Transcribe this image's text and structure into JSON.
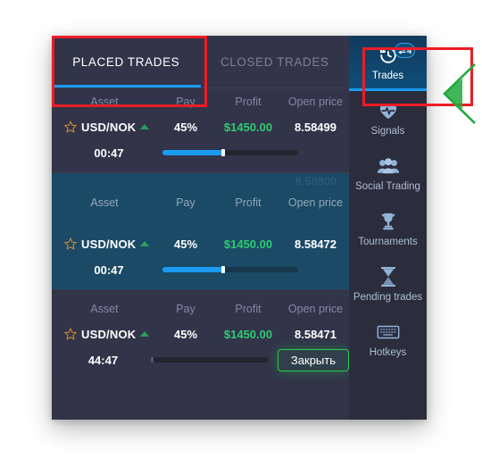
{
  "tabs": [
    {
      "label": "PLACED TRADES",
      "active": true
    },
    {
      "label": "CLOSED TRADES",
      "active": false
    }
  ],
  "columns": {
    "asset": "Asset",
    "pay": "Pay",
    "profit": "Profit",
    "open_price": "Open price"
  },
  "trades": [
    {
      "asset": "USD/NOK",
      "direction": "up",
      "favorite": true,
      "pay": "45%",
      "profit": "$1450.00",
      "open_price": "8.58499",
      "timer": "00:47",
      "progress_percent": 45,
      "ghost_price": "",
      "selected": false,
      "show_close_button": false,
      "close_label": ""
    },
    {
      "asset": "USD/NOK",
      "direction": "up",
      "favorite": true,
      "pay": "45%",
      "profit": "$1450.00",
      "open_price": "8.58472",
      "timer": "00:47",
      "progress_percent": 45,
      "ghost_price": "8.58800",
      "selected": true,
      "show_close_button": false,
      "close_label": ""
    },
    {
      "asset": "USD/NOK",
      "direction": "up",
      "favorite": true,
      "pay": "45%",
      "profit": "$1450.00",
      "open_price": "8.58471",
      "timer": "44:47",
      "progress_percent": 2,
      "ghost_price": "",
      "selected": false,
      "show_close_button": true,
      "close_label": "Закрыть"
    }
  ],
  "sidebar": {
    "items": [
      {
        "label": "Trades",
        "icon": "history-clock-icon",
        "active": true,
        "badge": "4"
      },
      {
        "label": "Signals",
        "icon": "heart-pulse-icon",
        "active": false,
        "badge": ""
      },
      {
        "label": "Social Trading",
        "icon": "people-group-icon",
        "active": false,
        "badge": ""
      },
      {
        "label": "Tournaments",
        "icon": "trophy-icon",
        "active": false,
        "badge": ""
      },
      {
        "label": "Pending trades",
        "icon": "hourglass-icon",
        "active": false,
        "badge": ""
      },
      {
        "label": "Hotkeys",
        "icon": "keyboard-icon",
        "active": false,
        "badge": ""
      }
    ]
  },
  "colors": {
    "accent_blue": "#1b9bf0",
    "profit_green": "#2ecc71",
    "annotation_red": "#ee1c25",
    "annotation_green": "#1fa93c",
    "selected_row": "#1a4a66",
    "panel_bg": "#32344a",
    "sidebar_bg": "#2b2d3c"
  }
}
